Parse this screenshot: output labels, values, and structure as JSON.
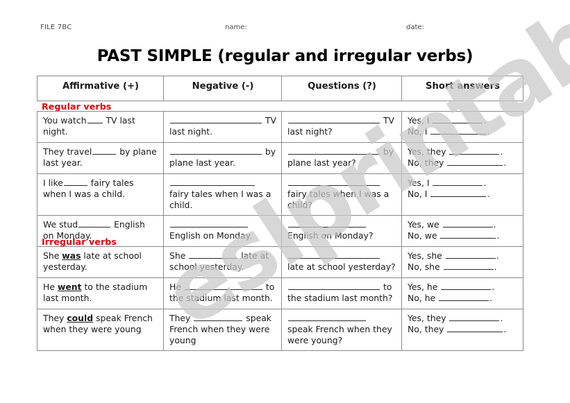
{
  "meta": {
    "file_label": "FILE 7BC",
    "name_label": "name:",
    "date_label": "date:"
  },
  "title": "PAST SIMPLE (regular and irregular verbs)",
  "watermark": {
    "text": "eslprintables.com",
    "color": "#c9c9c9"
  },
  "colors": {
    "section_red": "#e3000b",
    "border": "#8a8a8a",
    "text": "#1a1a1a"
  },
  "table": {
    "headers": [
      "Affirmative (+)",
      "Negative (-)",
      "Questions (?)",
      "Short answers"
    ]
  },
  "sections": {
    "regular": {
      "label": "Regular verbs",
      "rows": [
        {
          "affirmative_pre": "You watch",
          "affirmative_post": " TV last night.",
          "negative_pre": "",
          "negative_post": " TV last night.",
          "question_pre": "",
          "question_post": " TV last night?",
          "answer_yes_pre": "Yes, I ",
          "answer_yes_post": ".",
          "answer_no_pre": "No, I ",
          "answer_no_post": "."
        },
        {
          "affirmative_pre": "They travel",
          "affirmative_post": " by plane last year.",
          "negative_pre": "",
          "negative_post": " by plane last year.",
          "question_pre": "",
          "question_post": " by plane last year?",
          "answer_yes_pre": "Yes, they ",
          "answer_yes_post": ".",
          "answer_no_pre": "No, they ",
          "answer_no_post": "."
        },
        {
          "affirmative_pre": "I like",
          "affirmative_post": " fairy tales when I was a child.",
          "negative_pre": "",
          "negative_post": " fairy tales when I was a child.",
          "question_pre": "",
          "question_post": " fairy tales when I was a child?",
          "answer_yes_pre": "Yes, I ",
          "answer_yes_post": ".",
          "answer_no_pre": "No, I ",
          "answer_no_post": "."
        },
        {
          "affirmative_pre": "We stud",
          "affirmative_post": " English on Monday.",
          "negative_pre": "",
          "negative_post": " English on Monday.",
          "question_pre": "",
          "question_post": " English on Monday?",
          "answer_yes_pre": "Yes, we ",
          "answer_yes_post": ".",
          "answer_no_pre": "No, we ",
          "answer_no_post": "."
        }
      ]
    },
    "irregular": {
      "label": "Irregular verbs",
      "rows": [
        {
          "affirmative_pre": "She ",
          "affirmative_keyword": "was",
          "affirmative_post": " late at school yesterday.",
          "negative_pre": "She ",
          "negative_post": " late at school yesterday.",
          "question_pre": "",
          "question_post": " late at school yesterday?",
          "answer_yes_pre": "Yes, she ",
          "answer_yes_post": ".",
          "answer_no_pre": "No, she ",
          "answer_no_post": "."
        },
        {
          "affirmative_pre": "He ",
          "affirmative_keyword": "went",
          "affirmative_post": " to the stadium last month.",
          "negative_pre": "He ",
          "negative_post": " to the stadium last month.",
          "question_pre": "",
          "question_post": " to the stadium last month?",
          "answer_yes_pre": "Yes, he ",
          "answer_yes_post": ".",
          "answer_no_pre": "No, he ",
          "answer_no_post": "."
        },
        {
          "affirmative_pre": "They ",
          "affirmative_keyword": "could",
          "affirmative_post": " speak French when they were young",
          "negative_pre": "They ",
          "negative_post": " speak French when they were young",
          "question_pre": "",
          "question_post": " speak French when they were young?",
          "answer_yes_pre": "Yes, they ",
          "answer_yes_post": ".",
          "answer_no_pre": "No, they ",
          "answer_no_post": "."
        }
      ]
    }
  }
}
